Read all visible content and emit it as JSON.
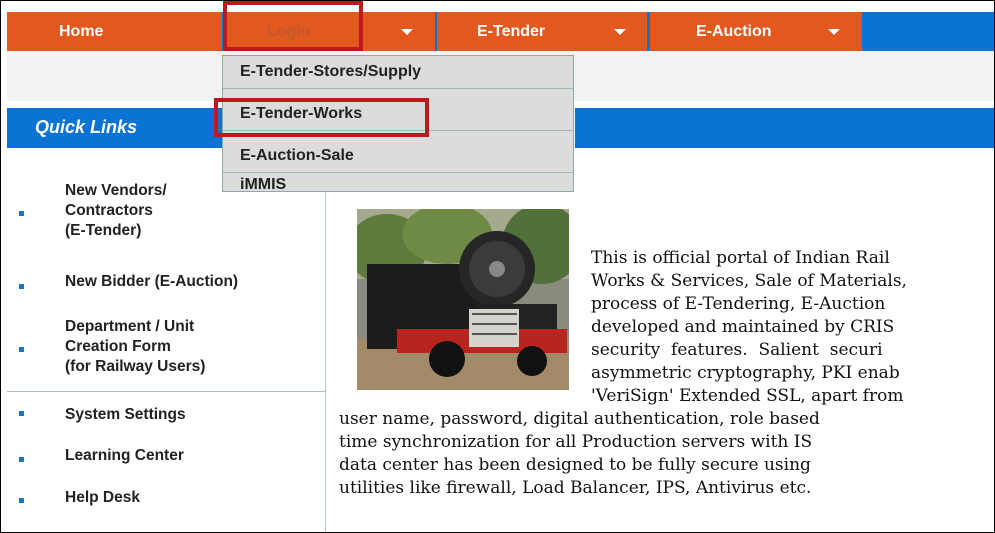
{
  "nav": {
    "home": "Home",
    "login": "Login",
    "etender": "E-Tender",
    "eauction": "E-Auction"
  },
  "dropdown": {
    "items": [
      "E-Tender-Stores/Supply",
      "E-Tender-Works",
      "E-Auction-Sale",
      "iMMIS"
    ]
  },
  "sidebar": {
    "title": "Quick Links",
    "items": [
      {
        "lines": [
          "New Vendors/",
          "Contractors",
          "(E-Tender)"
        ]
      },
      {
        "lines": [
          "New Bidder (E-Auction)"
        ]
      },
      {
        "lines": [
          "Department / Unit",
          "Creation Form",
          "(for Railway Users)"
        ]
      },
      {
        "lines": [
          "System Settings"
        ]
      },
      {
        "lines": [
          "Learning Center"
        ]
      },
      {
        "lines": [
          "Help Desk"
        ]
      }
    ]
  },
  "content": {
    "lines": [
      "This is official portal of Indian Rail",
      "Works & Services, Sale of Materials,",
      "process of E-Tendering, E-Auction",
      "developed and maintained by CRIS",
      "security  features.  Salient  securi",
      "asymmetric cryptography, PKI enab",
      "'VeriSign' Extended SSL, apart from",
      "user name, password, digital authentication, role based",
      "time synchronization for all Production servers with IS",
      "data center has been designed to be fully secure using",
      "utilities like firewall, Load Balancer, IPS, Antivirus etc."
    ]
  },
  "colors": {
    "nav_orange": "#e2581f",
    "nav_blue": "#0b73d4",
    "highlight_red": "#c0181f"
  }
}
